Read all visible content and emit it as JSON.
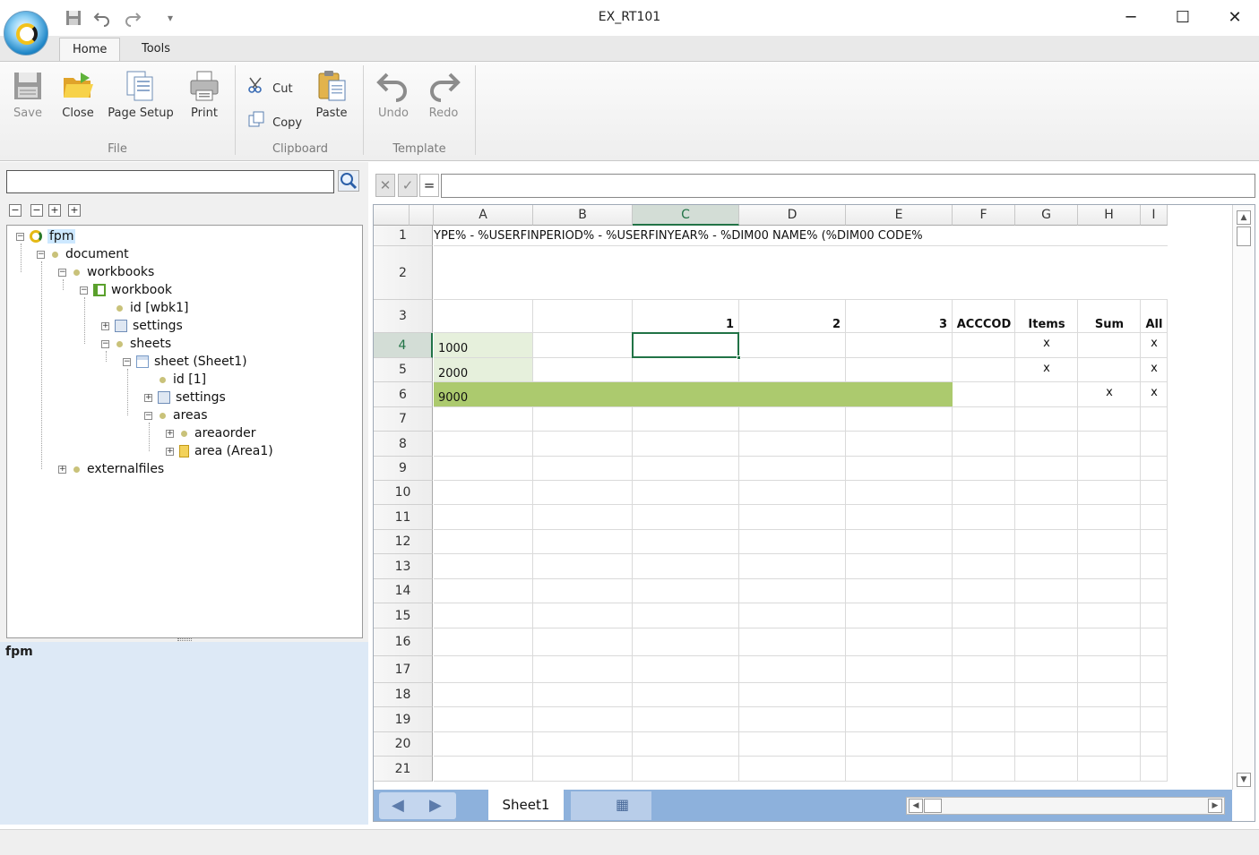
{
  "window": {
    "title": "EX_RT101",
    "minimize": "─",
    "maximize": "☐",
    "close": "✕"
  },
  "quick_access": {
    "save_icon": "floppy-disk",
    "undo_icon": "undo-arrow",
    "redo_icon": "redo-arrow",
    "customize_icon": "dropdown-arrow"
  },
  "ribbon": {
    "tabs": [
      "Home",
      "Tools"
    ],
    "active_tab": "Home",
    "groups": {
      "file": {
        "label": "File",
        "save": "Save",
        "close": "Close",
        "page_setup": "Page Setup",
        "print": "Print"
      },
      "clipboard": {
        "label": "Clipboard",
        "cut": "Cut",
        "copy": "Copy",
        "paste": "Paste"
      },
      "template": {
        "label": "Template",
        "undo": "Undo",
        "redo": "Redo"
      }
    }
  },
  "tree": {
    "search_value": "",
    "nodes": [
      {
        "label": "fpm"
      },
      {
        "label": "document"
      },
      {
        "label": "workbooks"
      },
      {
        "label": "workbook"
      },
      {
        "label": "id [wbk1]"
      },
      {
        "label": "settings"
      },
      {
        "label": "sheets"
      },
      {
        "label": "sheet (Sheet1)"
      },
      {
        "label": "id [1]"
      },
      {
        "label": "settings"
      },
      {
        "label": "areas"
      },
      {
        "label": "areaorder"
      },
      {
        "label": "area (Area1)"
      },
      {
        "label": "externalfiles"
      }
    ],
    "selected": "fpm"
  },
  "properties": {
    "title": "fpm"
  },
  "formula_bar": {
    "cancel": "✕",
    "confirm": "✓",
    "equals": "=",
    "value": ""
  },
  "sheet": {
    "columns": [
      "A",
      "B",
      "C",
      "D",
      "E",
      "F",
      "G",
      "H",
      "I"
    ],
    "selected_column": "C",
    "rows": [
      "1",
      "2",
      "3",
      "4",
      "5",
      "6",
      "7",
      "8",
      "9",
      "10",
      "11",
      "12",
      "13",
      "14",
      "15",
      "16",
      "17",
      "18",
      "19",
      "20",
      "21"
    ],
    "selected_row": "4",
    "row1_text": "YPE% - %USERFINPERIOD% - %USERFINYEAR% - %DIM00 NAME% (%DIM00 CODE%",
    "row3": {
      "C": "1",
      "D": "2",
      "E": "3",
      "F": "ACCCOD",
      "G": "Items",
      "H": "Sum",
      "I": "All"
    },
    "row4": {
      "A": "1000",
      "G": "x",
      "I": "x"
    },
    "row5": {
      "A": "2000",
      "G": "x",
      "I": "x"
    },
    "row6": {
      "A": "9000",
      "H": "x",
      "I": "x"
    },
    "highlight_color": "#acca6e",
    "light_highlight_color": "#e6f0dc",
    "active_cell_color": "#217346",
    "tab": "Sheet1"
  }
}
